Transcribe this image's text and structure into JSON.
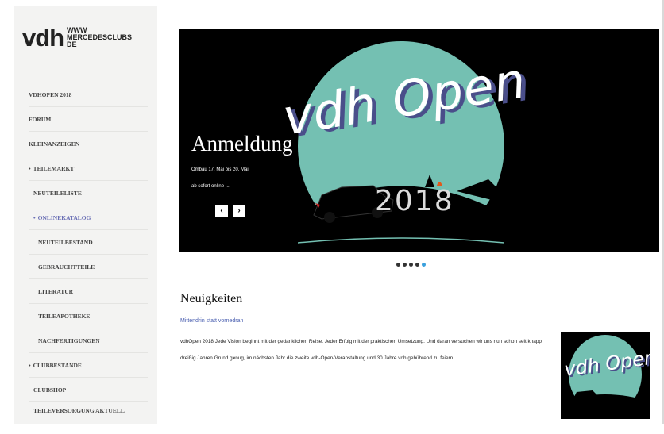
{
  "logo": {
    "main": "vdh",
    "lines": [
      "WWW",
      "MERCEDESCLUBS",
      "DE"
    ]
  },
  "nav": [
    {
      "label": "VDHOPEN 2018",
      "indent": 0,
      "bullet": false,
      "active": false
    },
    {
      "label": "FORUM",
      "indent": 0,
      "bullet": false,
      "active": false
    },
    {
      "label": "KLEINANZEIGEN",
      "indent": 0,
      "bullet": false,
      "active": false
    },
    {
      "label": "TEILEMARKT",
      "indent": 0,
      "bullet": true,
      "active": false
    },
    {
      "label": "NEUTEILELISTE",
      "indent": 1,
      "bullet": false,
      "active": false
    },
    {
      "label": "ONLINEKATALOG",
      "indent": 1,
      "bullet": true,
      "active": true
    },
    {
      "label": "NEUTEILBESTAND",
      "indent": 2,
      "bullet": false,
      "active": false
    },
    {
      "label": "GEBRAUCHTTEILE",
      "indent": 2,
      "bullet": false,
      "active": false
    },
    {
      "label": "LITERATUR",
      "indent": 2,
      "bullet": false,
      "active": false
    },
    {
      "label": "TEILEAPOTHEKE",
      "indent": 2,
      "bullet": false,
      "active": false
    },
    {
      "label": "NACHFERTIGUNGEN",
      "indent": 2,
      "bullet": false,
      "active": false
    },
    {
      "label": "CLUBBESTÄNDE",
      "indent": 0,
      "bullet": true,
      "active": false
    },
    {
      "label": "CLUBSHOP",
      "indent": 1,
      "bullet": false,
      "active": false
    },
    {
      "label": "TEILEVERSORGUNG AKTUELL",
      "indent": 1,
      "bullet": false,
      "active": false
    }
  ],
  "slider": {
    "title": "Anmeldung",
    "line1": "Ombau 17. Mai bis 20. Mai",
    "line2": "ab sofort online ...",
    "prev": "‹",
    "next": "›",
    "logo_text": "vdh Open",
    "year": "2018",
    "slide_count": 5,
    "active_slide": 4
  },
  "news": {
    "heading": "Neuigkeiten",
    "link": "Mittendrin statt vorne­dran",
    "body": "vdhOpen 2018 Jede Vision beginnt mit der gedanklichen Reise. Jeder Erfolg mit der praktischen Umsetzung. Und daran versuchen wir uns nun schon seit knapp dreißig Jahren.Grund genug, im nächsten Jahr die zweite vdh-Open-Veranstaltung und 30 Jahre vdh gebührend zu feiern.....",
    "thumb_text": "vdh Open"
  },
  "colors": {
    "accent": "#6a6fb5",
    "moon": "#74c0b2",
    "dot_active": "#3aa0dd",
    "link": "#4a5fb0"
  }
}
